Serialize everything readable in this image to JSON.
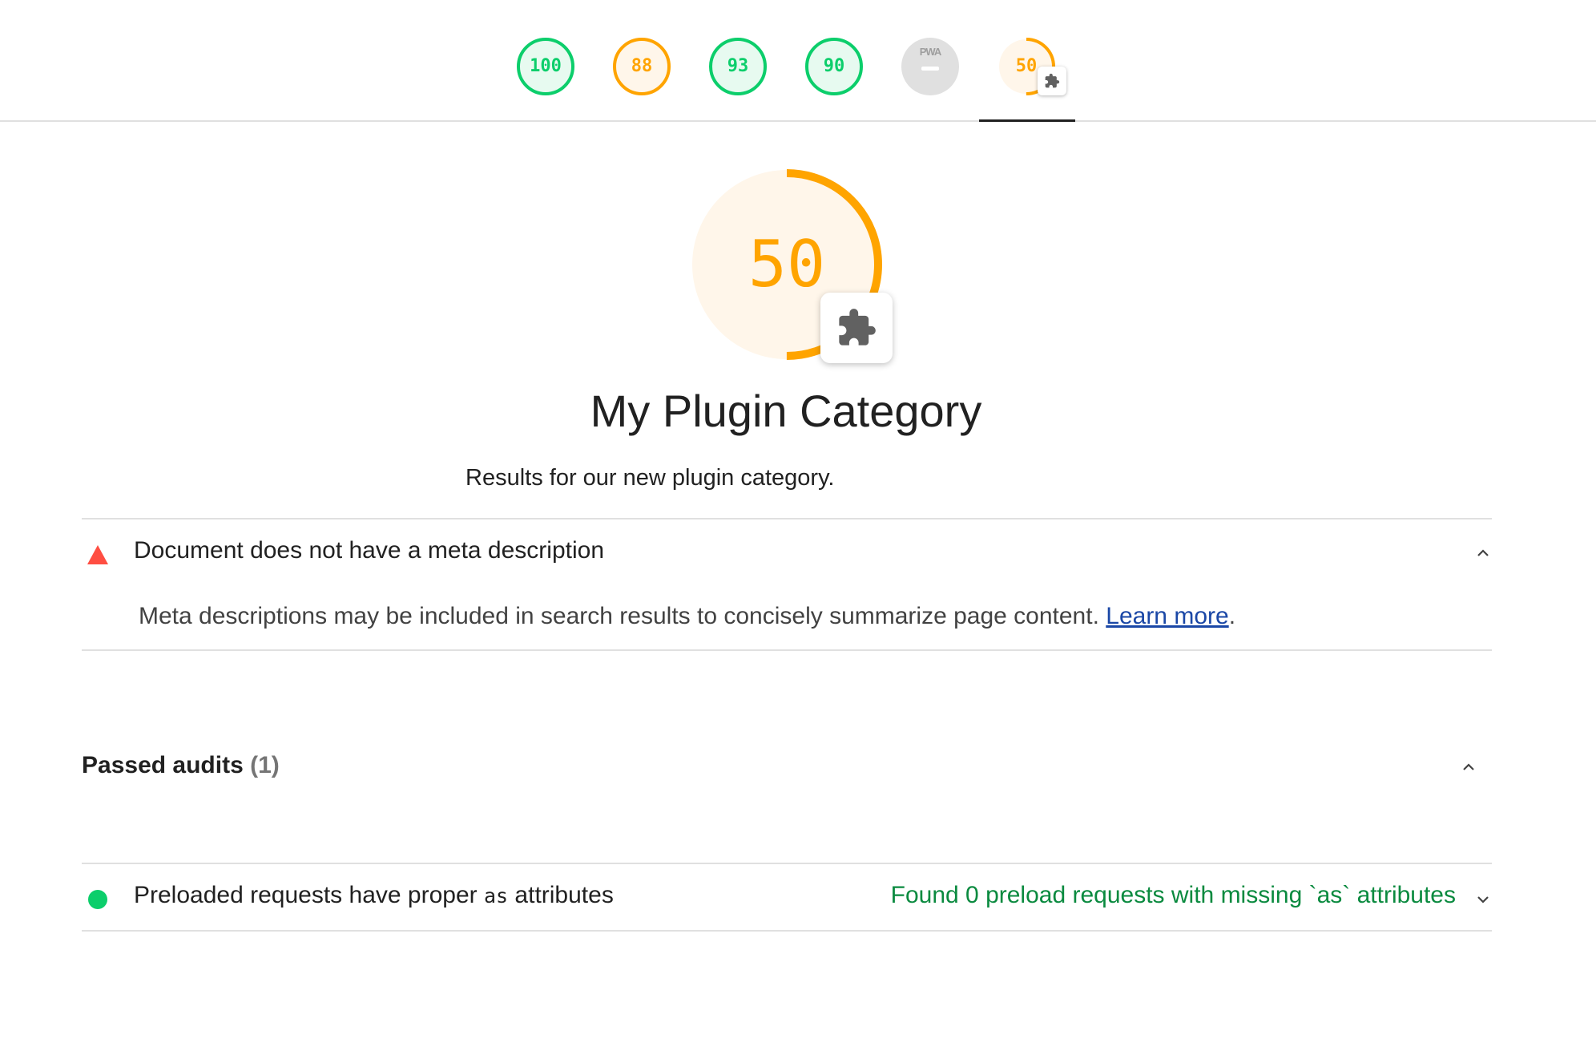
{
  "nav": {
    "gauges": [
      {
        "score": "100",
        "status": "pass"
      },
      {
        "score": "88",
        "status": "average"
      },
      {
        "score": "93",
        "status": "pass"
      },
      {
        "score": "90",
        "status": "pass"
      },
      {
        "score": "",
        "status": "pwa",
        "label": "PWA"
      },
      {
        "score": "50",
        "status": "average",
        "icon": "puzzle-piece-icon",
        "selected": true
      }
    ]
  },
  "category": {
    "score": "50",
    "score_fraction": 0.5,
    "icon": "puzzle-piece-icon",
    "title": "My Plugin Category",
    "description": "Results for our new plugin category."
  },
  "failed_audit": {
    "icon": "fail-triangle-icon",
    "title": "Document does not have a meta description",
    "description": "Meta descriptions may be included in search results to concisely summarize page content.",
    "link_text": "Learn more",
    "trailing": "."
  },
  "passed_group": {
    "title": "Passed audits",
    "count": "(1)",
    "audits": [
      {
        "icon": "pass-circle-icon",
        "title_before": "Preloaded requests have proper",
        "title_code": "as",
        "title_after": "attributes",
        "display_value": "Found 0 preload requests with missing `as` attributes"
      }
    ]
  },
  "colors": {
    "pass": "#0cce6b",
    "average": "#ffa400",
    "fail": "#ff4e42",
    "pwa_gray": "#e0e0e0",
    "link": "#1a47a6"
  }
}
